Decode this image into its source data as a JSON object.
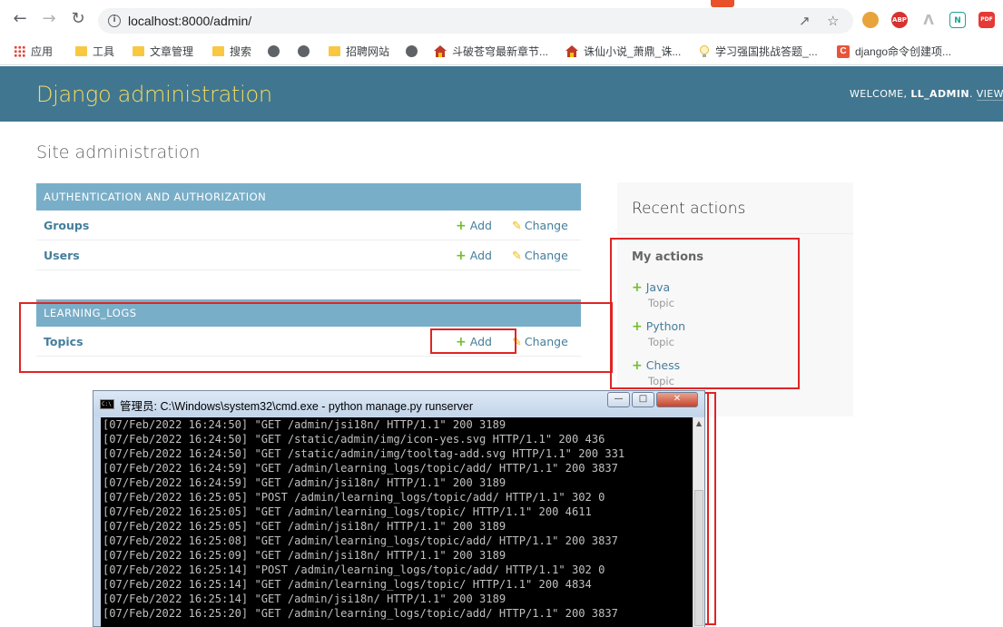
{
  "browser": {
    "url": "localhost:8000/admin/",
    "bookmarks": [
      {
        "label": "应用",
        "icon": "apps-grid-icon"
      },
      {
        "label": "工具",
        "icon": "folder-icon"
      },
      {
        "label": "文章管理",
        "icon": "folder-icon"
      },
      {
        "label": "搜索",
        "icon": "folder-icon"
      },
      {
        "label": "",
        "icon": "globe-icon"
      },
      {
        "label": "",
        "icon": "globe-icon"
      },
      {
        "label": "招聘网站",
        "icon": "folder-icon"
      },
      {
        "label": "",
        "icon": "globe-icon"
      },
      {
        "label": "斗破苍穹最新章节...",
        "icon": "house-icon"
      },
      {
        "label": "诛仙小说_萧鼎_诛...",
        "icon": "house-icon"
      },
      {
        "label": "学习强国挑战答题_...",
        "icon": "bulb-icon"
      },
      {
        "label": "django命令创建项...",
        "icon": "c-icon"
      }
    ],
    "extensions": [
      {
        "label": "",
        "color": "#e8a33d"
      },
      {
        "label": "ABP",
        "color": "#d9312f"
      },
      {
        "label": "",
        "color": "#bbbbbb"
      },
      {
        "label": "N",
        "color": "#1aa396"
      },
      {
        "label": "PDF",
        "color": "#e53935"
      },
      {
        "label": "",
        "color": "#1565c0"
      }
    ],
    "topbar_cut_colors": [
      "#e8512a",
      "#2a6fe8",
      "#2a6fe8",
      "#2a6fe8",
      "#2a6fe8",
      "#2a6fe8"
    ]
  },
  "django": {
    "brand": "Django administration",
    "welcome": "WELCOME, ",
    "username": "LL_ADMIN",
    "view_site": "VIEW SITE",
    "site_title": "Site administration",
    "modules": [
      {
        "caption": "AUTHENTICATION AND AUTHORIZATION",
        "models": [
          {
            "name": "Groups",
            "add": "Add",
            "change": "Change"
          },
          {
            "name": "Users",
            "add": "Add",
            "change": "Change"
          }
        ]
      },
      {
        "caption": "LEARNING_LOGS",
        "models": [
          {
            "name": "Topics",
            "add": "Add",
            "change": "Change"
          }
        ]
      }
    ],
    "recent": {
      "title": "Recent actions",
      "my_actions": "My actions",
      "items": [
        {
          "name": "Java",
          "type": "Topic"
        },
        {
          "name": "Python",
          "type": "Topic"
        },
        {
          "name": "Chess",
          "type": "Topic"
        }
      ]
    },
    "colors": {
      "header": "#417690",
      "brand": "#f5dd5d",
      "caption": "#79aec8",
      "link": "#447e9b",
      "add_green": "#70bf2b",
      "change_yellow": "#efb80b",
      "highlight_red": "#e02424"
    }
  },
  "cmd": {
    "title": "管理员: C:\\Windows\\system32\\cmd.exe - python  manage.py runserver",
    "lines": [
      "[07/Feb/2022 16:24:50] \"GET /admin/jsi18n/ HTTP/1.1\" 200 3189",
      "[07/Feb/2022 16:24:50] \"GET /static/admin/img/icon-yes.svg HTTP/1.1\" 200 436",
      "[07/Feb/2022 16:24:50] \"GET /static/admin/img/tooltag-add.svg HTTP/1.1\" 200 331",
      "[07/Feb/2022 16:24:59] \"GET /admin/learning_logs/topic/add/ HTTP/1.1\" 200 3837",
      "[07/Feb/2022 16:24:59] \"GET /admin/jsi18n/ HTTP/1.1\" 200 3189",
      "[07/Feb/2022 16:25:05] \"POST /admin/learning_logs/topic/add/ HTTP/1.1\" 302 0",
      "[07/Feb/2022 16:25:05] \"GET /admin/learning_logs/topic/ HTTP/1.1\" 200 4611",
      "[07/Feb/2022 16:25:05] \"GET /admin/jsi18n/ HTTP/1.1\" 200 3189",
      "[07/Feb/2022 16:25:08] \"GET /admin/learning_logs/topic/add/ HTTP/1.1\" 200 3837",
      "[07/Feb/2022 16:25:09] \"GET /admin/jsi18n/ HTTP/1.1\" 200 3189",
      "[07/Feb/2022 16:25:14] \"POST /admin/learning_logs/topic/add/ HTTP/1.1\" 302 0",
      "[07/Feb/2022 16:25:14] \"GET /admin/learning_logs/topic/ HTTP/1.1\" 200 4834",
      "[07/Feb/2022 16:25:14] \"GET /admin/jsi18n/ HTTP/1.1\" 200 3189",
      "[07/Feb/2022 16:25:20] \"GET /admin/learning_logs/topic/add/ HTTP/1.1\" 200 3837"
    ]
  }
}
